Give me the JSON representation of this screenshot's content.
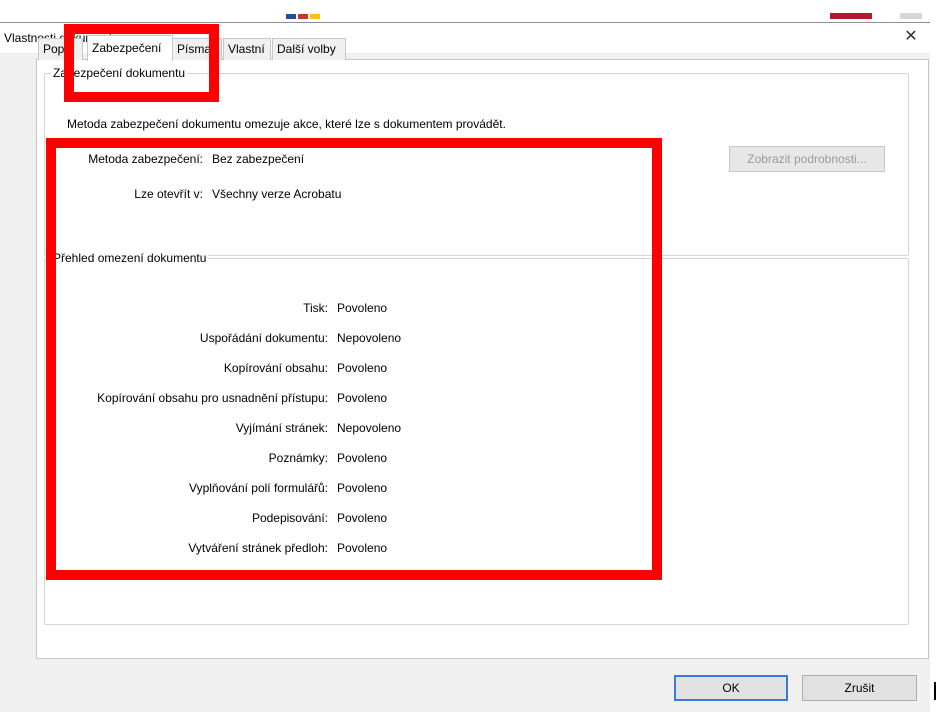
{
  "dialog": {
    "title": "Vlastnosti dokumentu"
  },
  "tabs": [
    {
      "label": "Popis",
      "active": false
    },
    {
      "label": "Zabezpečení",
      "active": true
    },
    {
      "label": "Písma",
      "active": false
    },
    {
      "label": "Vlastní",
      "active": false
    },
    {
      "label": "Další volby",
      "active": false
    }
  ],
  "security": {
    "group_label": "Zabezpečení dokumentu",
    "description": "Metoda zabezpečení dokumentu omezuje akce, které lze s dokumentem provádět.",
    "method_label": "Metoda zabezpečení:",
    "method_value": "Bez zabezpečení",
    "open_label": "Lze otevřít v:",
    "open_value": "Všechny verze Acrobatu",
    "details_button": "Zobrazit podrobnosti..."
  },
  "restrictions": {
    "group_label": "Přehled omezení dokumentu",
    "rows": [
      {
        "label": "Tisk:",
        "value": "Povoleno"
      },
      {
        "label": "Uspořádání dokumentu:",
        "value": "Nepovoleno"
      },
      {
        "label": "Kopírování obsahu:",
        "value": "Povoleno"
      },
      {
        "label": "Kopírování obsahu pro usnadnění přístupu:",
        "value": "Povoleno"
      },
      {
        "label": "Vyjímání stránek:",
        "value": "Nepovoleno"
      },
      {
        "label": "Poznámky:",
        "value": "Povoleno"
      },
      {
        "label": "Vyplňování polí formulářů:",
        "value": "Povoleno"
      },
      {
        "label": "Podepisování:",
        "value": "Povoleno"
      },
      {
        "label": "Vytváření stránek předloh:",
        "value": "Povoleno"
      }
    ]
  },
  "buttons": {
    "ok": "OK",
    "cancel": "Zrušit"
  },
  "icons": {
    "close": "close-icon"
  },
  "colors": {
    "highlight": "#ff0000",
    "dialog_bg": "#f0f0f0",
    "panel_bg": "#ffffff"
  }
}
